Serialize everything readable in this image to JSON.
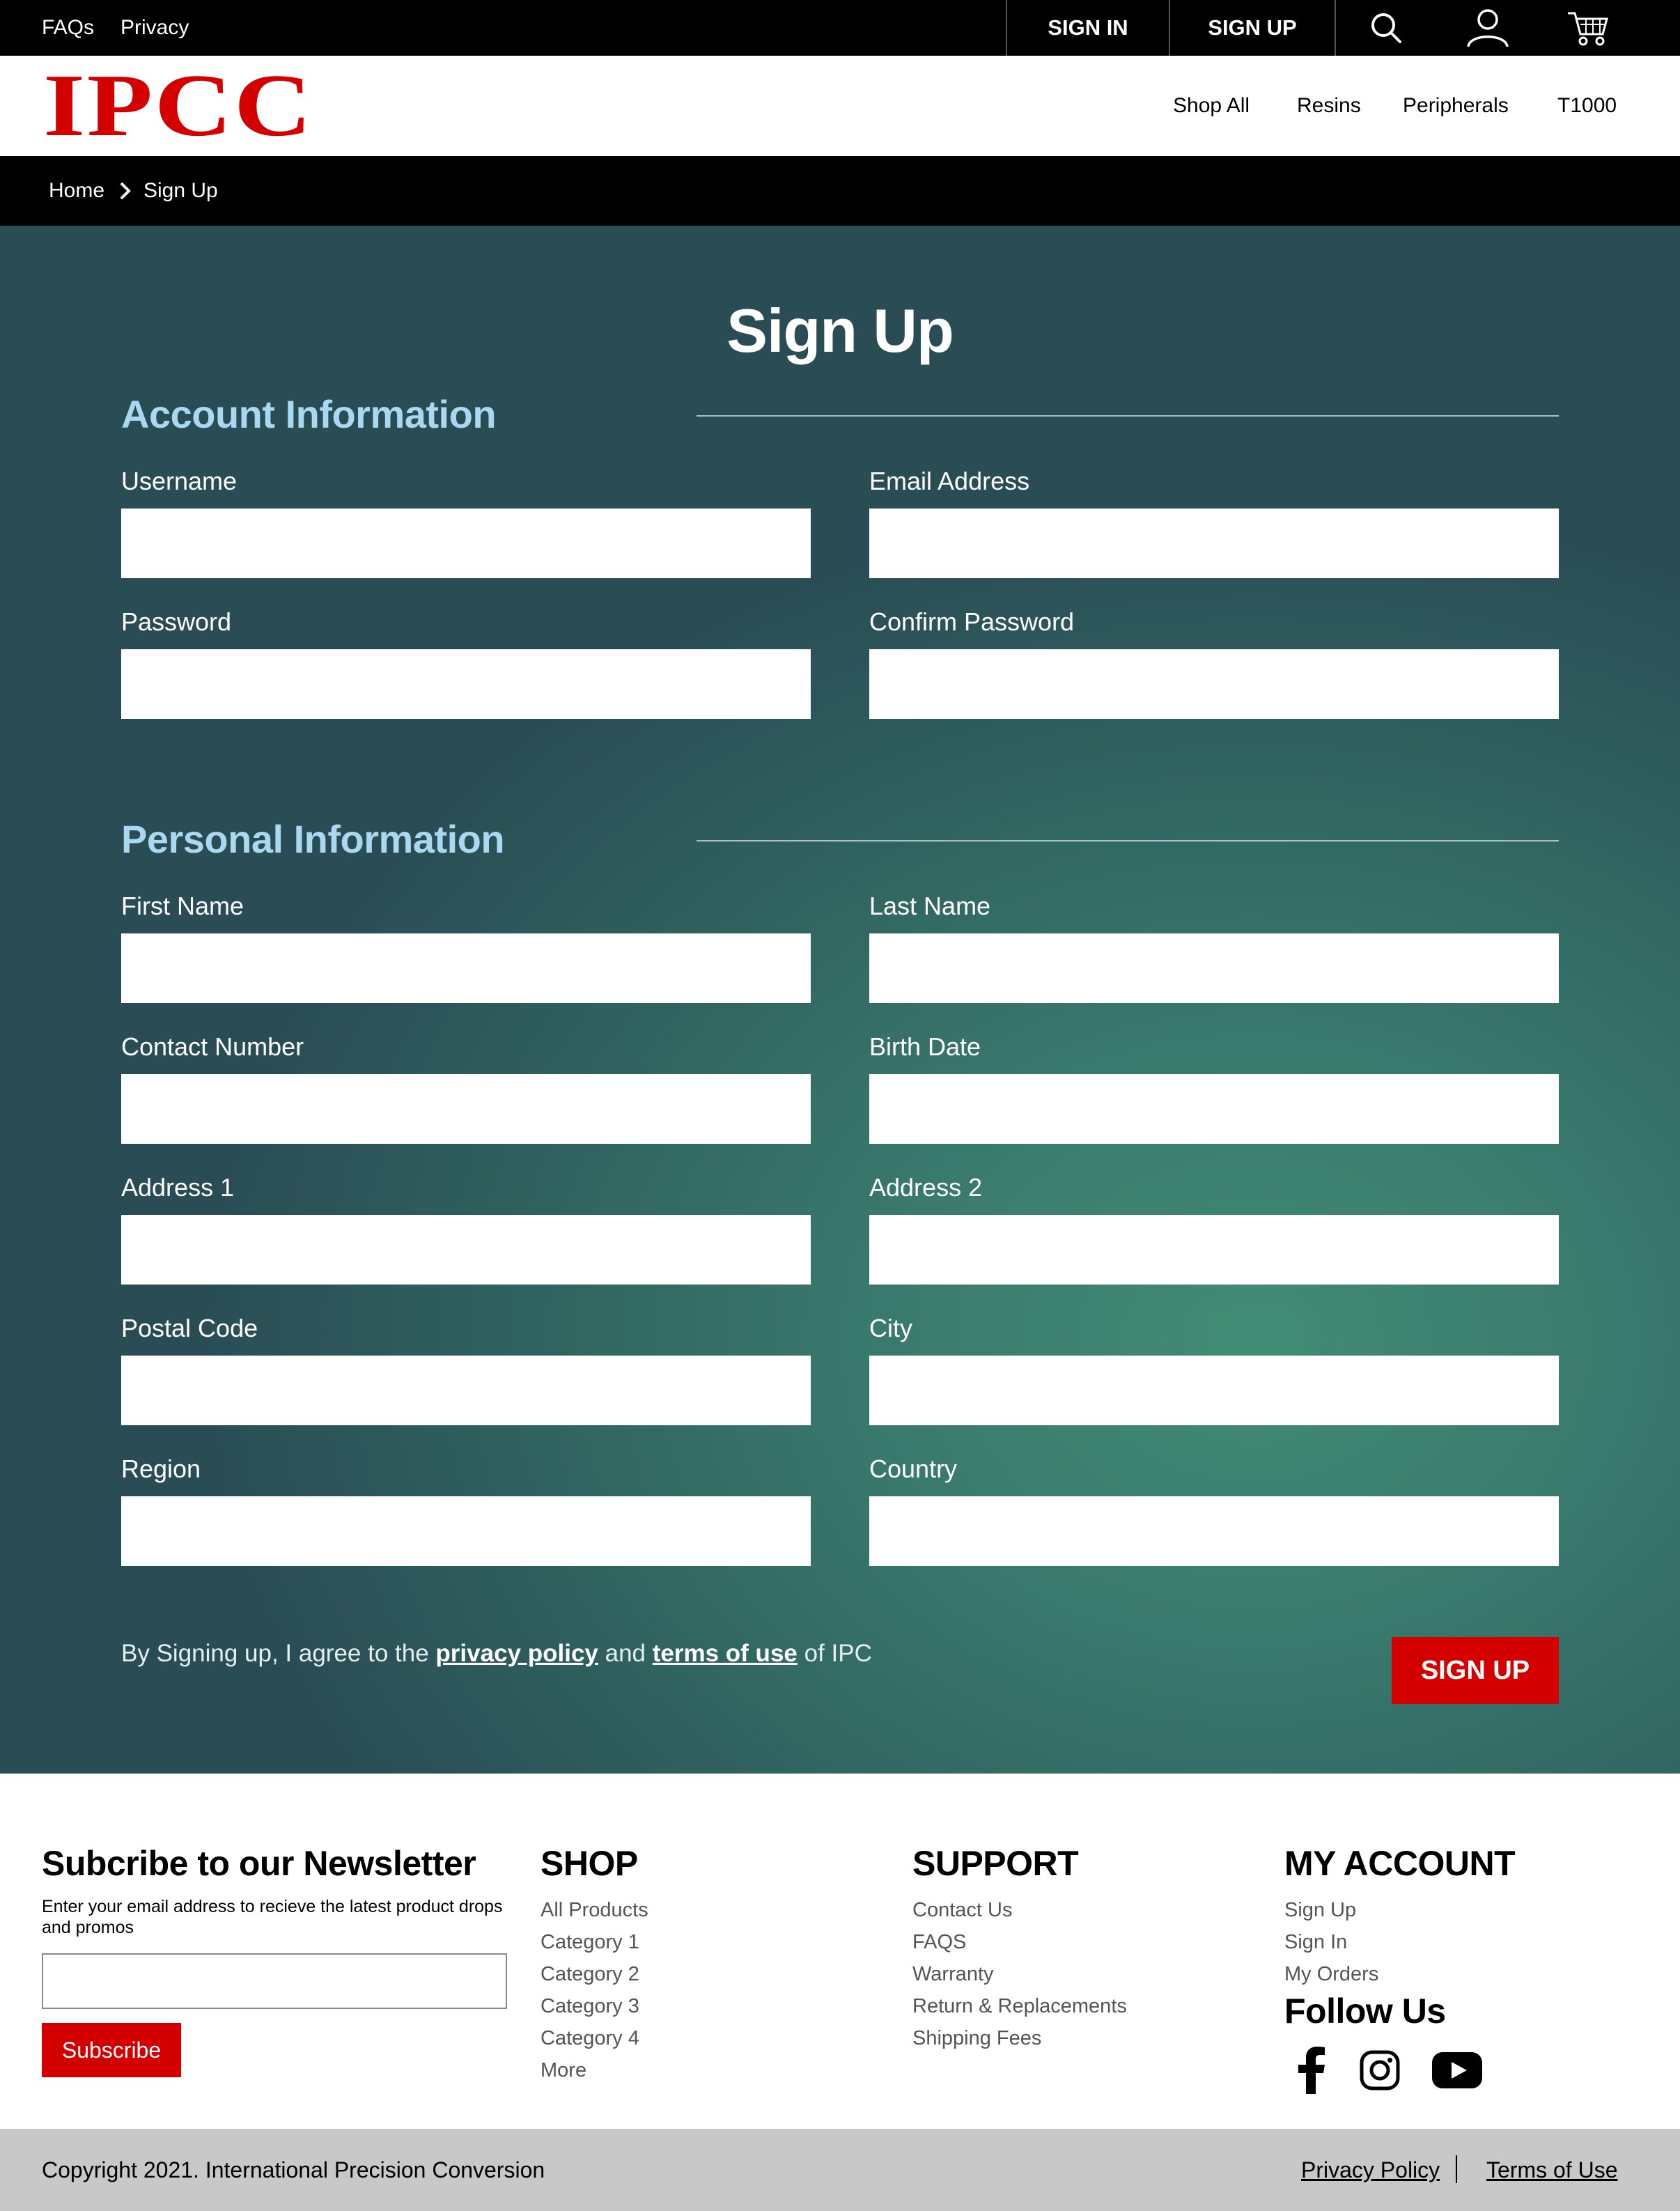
{
  "topbar": {
    "faqs": "FAQs",
    "privacy": "Privacy",
    "sign_in": "SIGN IN",
    "sign_up": "SIGN UP",
    "icons": [
      "search-icon",
      "user-icon",
      "cart-icon"
    ]
  },
  "header": {
    "logo_text": "IPCC",
    "nav": [
      "Shop All",
      "Resins",
      "Peripherals",
      "T1000"
    ]
  },
  "breadcrumb": {
    "home": "Home",
    "current": "Sign Up"
  },
  "form": {
    "title": "Sign Up",
    "account_section": "Account Information",
    "personal_section": "Personal Information",
    "fields": {
      "username": "Username",
      "email": "Email Address",
      "password": "Password",
      "confirm_password": "Confirm Password",
      "first_name": "First Name",
      "last_name": "Last Name",
      "contact_number": "Contact Number",
      "birth_date": "Birth Date",
      "address1": "Address 1",
      "address2": "Address 2",
      "postal_code": "Postal Code",
      "city": "City",
      "region": "Region",
      "country": "Country"
    },
    "agree_prefix": "By Signing up, I agree to the",
    "privacy_policy": "privacy policy",
    "and": "and",
    "terms_of_use": "terms of use",
    "agree_suffix": "of IPC",
    "submit": "SIGN UP"
  },
  "footer": {
    "newsletter_title": "Subcribe to our Newsletter",
    "newsletter_desc": "Enter your email address to recieve the latest product drops and promos",
    "subscribe": "Subscribe",
    "shop_title": "SHOP",
    "shop_links": [
      "All Products",
      "Category 1",
      "Category 2",
      "Category 3",
      "Category 4",
      "More"
    ],
    "support_title": "SUPPORT",
    "support_links": [
      "Contact Us",
      "FAQS",
      "Warranty",
      "Return & Replacements",
      "Shipping Fees"
    ],
    "account_title": "MY ACCOUNT",
    "account_links": [
      "Sign Up",
      "Sign In",
      "My Orders"
    ],
    "follow_title": "Follow Us",
    "social_icons": [
      "facebook-icon",
      "instagram-icon",
      "youtube-icon"
    ]
  },
  "bottom": {
    "copyright": "Copyright 2021. International Precision Conversion",
    "privacy_policy": "Privacy Policy",
    "terms_of_use": "Terms of Use"
  },
  "colors": {
    "brand_red": "#d40000",
    "section_title": "#a9d8f0",
    "gradient_light": "#428c75",
    "gradient_dark": "#2a4d55"
  }
}
